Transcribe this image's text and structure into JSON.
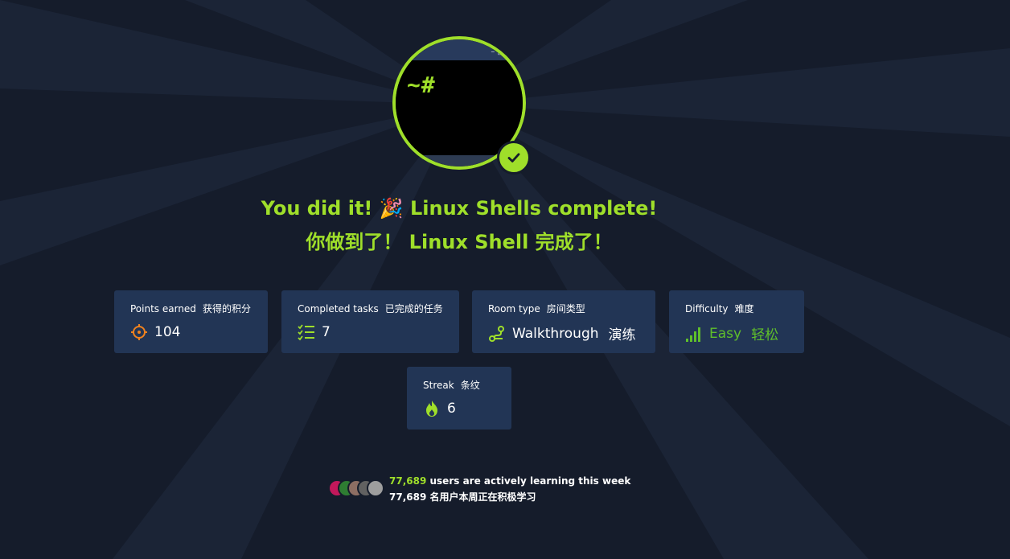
{
  "hero": {
    "prompt": "~#",
    "window_buttons": "– □",
    "icon": "terminal-icon",
    "badge_icon": "check-icon"
  },
  "headline": {
    "line1": "You did it! 🎉 Linux Shells complete!",
    "line2": "你做到了！ Linux Shell 完成了！"
  },
  "stats": {
    "points": {
      "label": "Points earned",
      "label_zh": "获得的积分",
      "value": "104",
      "icon": "target-icon"
    },
    "tasks": {
      "label": "Completed tasks",
      "label_zh": "已完成的任务",
      "value": "7",
      "icon": "checklist-icon"
    },
    "room_type": {
      "label": "Room type",
      "label_zh": "房间类型",
      "value": "Walkthrough",
      "value_zh": "演练",
      "icon": "route-icon"
    },
    "difficulty": {
      "label": "Difficulty",
      "label_zh": "难度",
      "value": "Easy",
      "value_zh": "轻松",
      "icon": "signal-bars-icon",
      "color": "#5fbf2b"
    },
    "streak": {
      "label": "Streak",
      "label_zh": "条纹",
      "value": "6",
      "icon": "flame-icon"
    }
  },
  "users": {
    "count": "77,689",
    "text": "users are actively learning this week",
    "count_zh": "77,689",
    "text_zh": "名用户本周正在积极学习"
  },
  "colors": {
    "background": "#151c2b",
    "accent": "#9fdf2a",
    "card": "#223555",
    "points_icon": "#f0821e"
  }
}
